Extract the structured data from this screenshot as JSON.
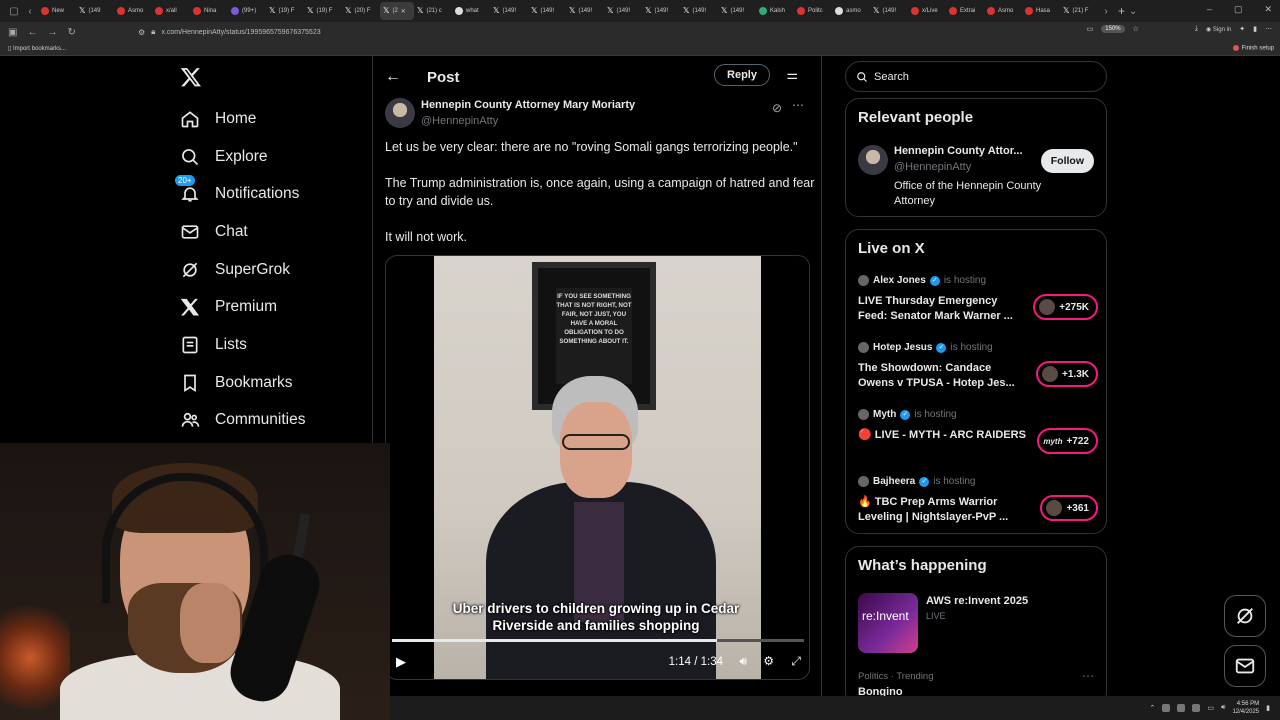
{
  "browser": {
    "tabs": [
      "New",
      "(149",
      "Asmo",
      "x/all",
      "Nina",
      "(99+)",
      "(19) F",
      "(19) F",
      "(20) F",
      "(2",
      "(21) c",
      "what",
      "(149!",
      "(149!",
      "(149!",
      "(149!",
      "(149!",
      "(149!",
      "(149!",
      "Kalsh",
      "Politc",
      "asmo",
      "(149!",
      "x/Live",
      "Extrai",
      "Asmo",
      "Hasa",
      "(21) F"
    ],
    "active_tab_index": 9,
    "url": "x.com/HennepinAtty/status/1995965759676375523",
    "zoom": "150%",
    "sign_in": "Sign in",
    "bookmark": "Import bookmarks...",
    "finish_setup": "Finish setup"
  },
  "nav": {
    "items": [
      {
        "label": "Home",
        "icon": "home-icon"
      },
      {
        "label": "Explore",
        "icon": "search-icon"
      },
      {
        "label": "Notifications",
        "icon": "bell-icon",
        "badge": "20+"
      },
      {
        "label": "Chat",
        "icon": "mail-icon"
      },
      {
        "label": "SuperGrok",
        "icon": "grok-icon"
      },
      {
        "label": "Premium",
        "icon": "x-logo-icon"
      },
      {
        "label": "Lists",
        "icon": "list-icon"
      },
      {
        "label": "Bookmarks",
        "icon": "bookmark-icon"
      },
      {
        "label": "Communities",
        "icon": "people-icon"
      }
    ]
  },
  "post": {
    "title": "Post",
    "reply_label": "Reply",
    "author_name": "Hennepin County Attorney Mary Moriarty",
    "author_handle": "@HennepinAtty",
    "paragraphs": [
      "Let us be very clear: there are no \"roving Somali gangs terrorizing people.\"",
      "The Trump administration is, once again, using a campaign of hatred and fear to try and divide us.",
      "It will not work."
    ],
    "video": {
      "poster_text": "If you see something that is not right, not fair, not just, you have a moral obligation to do something about it.",
      "caption": "Uber drivers to children growing up in Cedar Riverside and families shopping",
      "time": "1:14 / 1:34",
      "progress": 0.79
    }
  },
  "right": {
    "search_placeholder": "Search",
    "relevant": {
      "title": "Relevant people",
      "name": "Hennepin County Attor...",
      "handle": "@HennepinAtty",
      "bio": "Office of the Hennepin County Attorney",
      "follow_label": "Follow"
    },
    "live": {
      "title": "Live on X",
      "items": [
        {
          "host": "Alex Jones",
          "hosting": "is hosting",
          "title": "LIVE Thursday Emergency Feed: Senator Mark Warner ...",
          "count": "+275K"
        },
        {
          "host": "Hotep Jesus",
          "hosting": "is hosting",
          "title": "The Showdown: Candace Owens v TPUSA - Hotep Jes...",
          "count": "+1.3K"
        },
        {
          "host": "Myth",
          "hosting": "is hosting",
          "title": "🔴 LIVE - MYTH - ARC RAIDERS",
          "count": "+722"
        },
        {
          "host": "Bajheera",
          "hosting": "is hosting",
          "title": "🔥 TBC Prep Arms Warrior Leveling | Nightslayer-PvP ...",
          "count": "+361"
        }
      ]
    },
    "happening": {
      "title": "What’s happening",
      "event_title": "AWS re:Invent 2025",
      "event_sub": "LIVE",
      "event_thumb": "re:Invent",
      "trend_meta": "Politics · Trending",
      "trend_name": "Bongino"
    }
  },
  "taskbar": {
    "time": "4:56 PM",
    "date": "12/4/2025"
  }
}
